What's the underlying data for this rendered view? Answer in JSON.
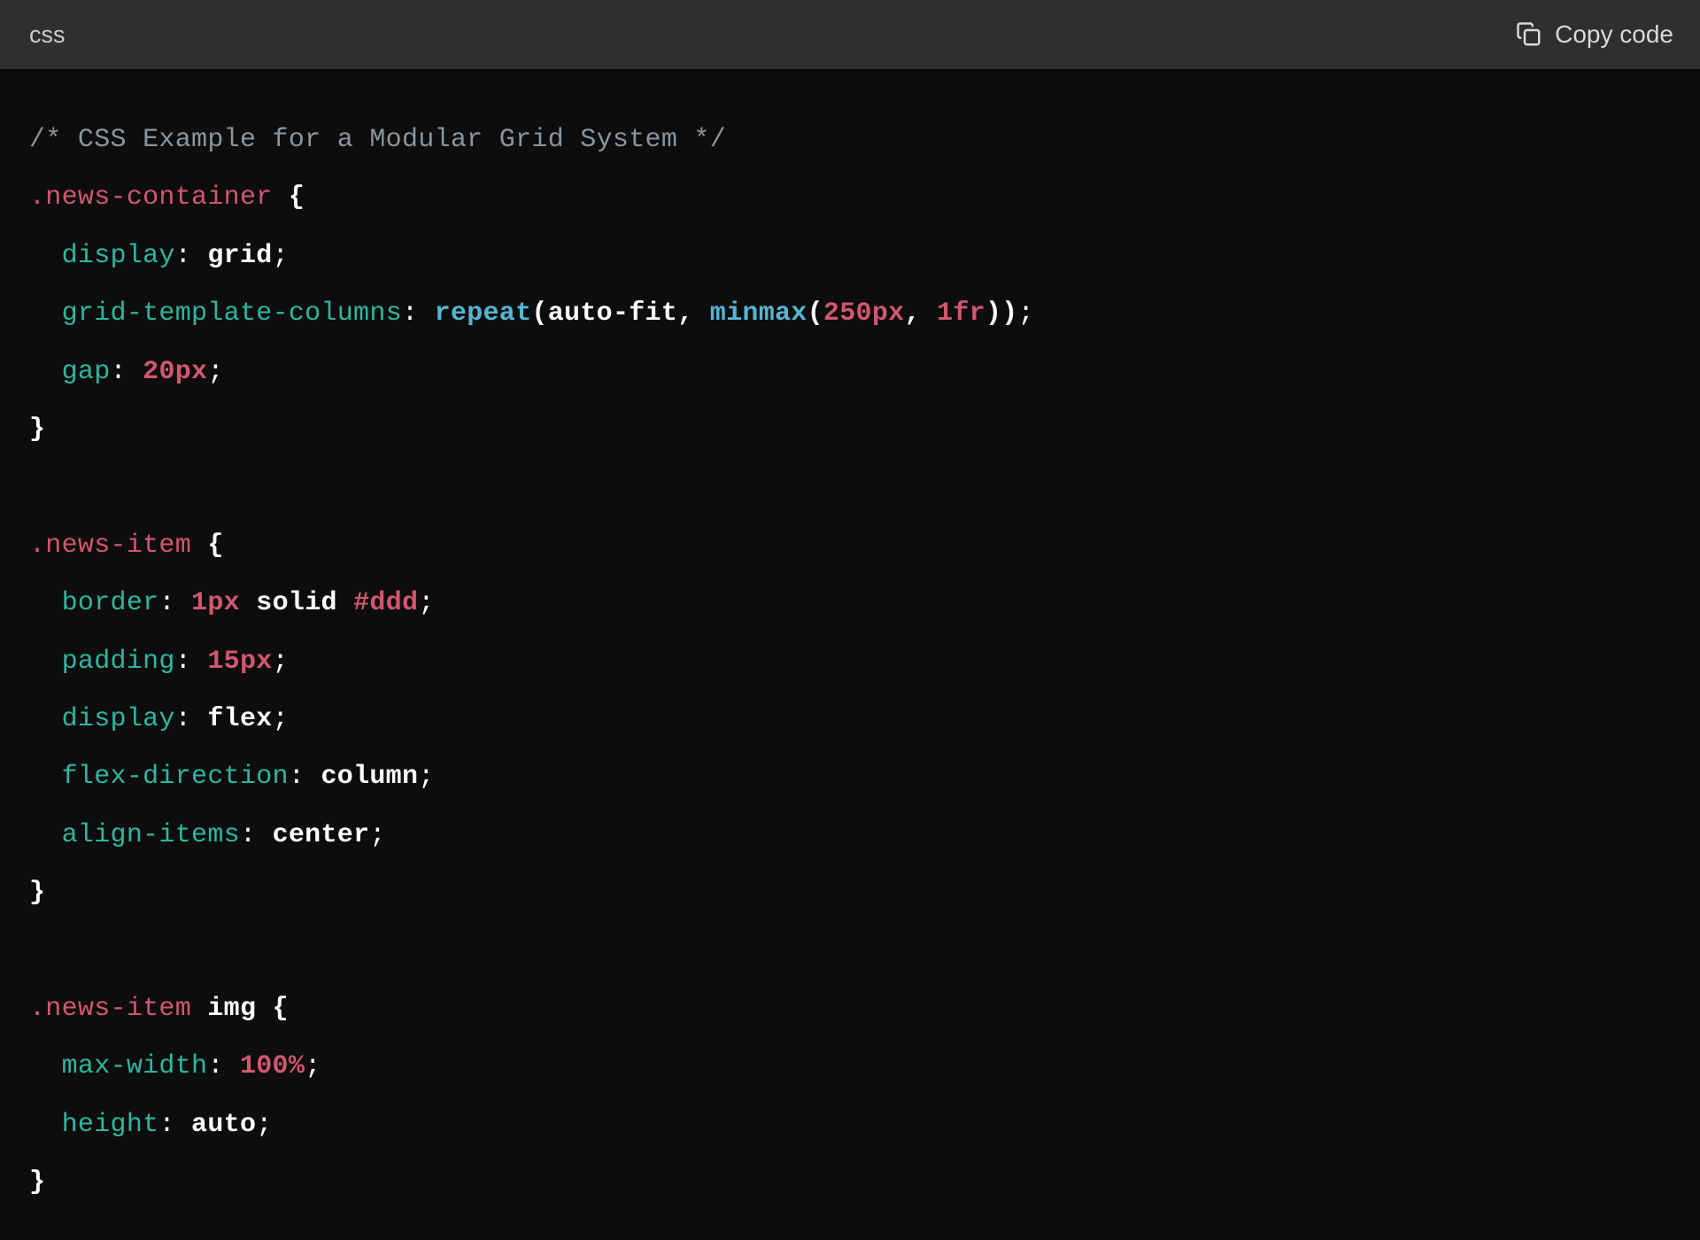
{
  "header": {
    "language_label": "css",
    "copy_label": "Copy code"
  },
  "code": {
    "line1_comment": "/* CSS Example for a Modular Grid System */",
    "sel_news_container": ".news-container",
    "prop_display": "display",
    "val_grid": "grid",
    "prop_grid_template_columns": "grid-template-columns",
    "func_repeat": "repeat",
    "val_auto_fit": "auto-fit",
    "func_minmax": "minmax",
    "num_250": "250",
    "unit_px": "px",
    "num_1": "1",
    "unit_fr": "fr",
    "prop_gap": "gap",
    "num_20": "20",
    "sel_news_item": ".news-item",
    "prop_border": "border",
    "val_solid": "solid",
    "hex_ddd": "#ddd",
    "prop_padding": "padding",
    "num_15": "15",
    "val_flex": "flex",
    "prop_flex_direction": "flex-direction",
    "val_column": "column",
    "prop_align_items": "align-items",
    "val_center": "center",
    "tag_img": "img",
    "prop_max_width": "max-width",
    "num_100": "100",
    "unit_pct": "%",
    "prop_height": "height",
    "val_auto": "auto",
    "brace_open": " {",
    "brace_close": "}",
    "colon_sp": ": ",
    "semicolon": ";",
    "paren_open": "(",
    "paren_close": ")",
    "comma_sp": ", "
  }
}
